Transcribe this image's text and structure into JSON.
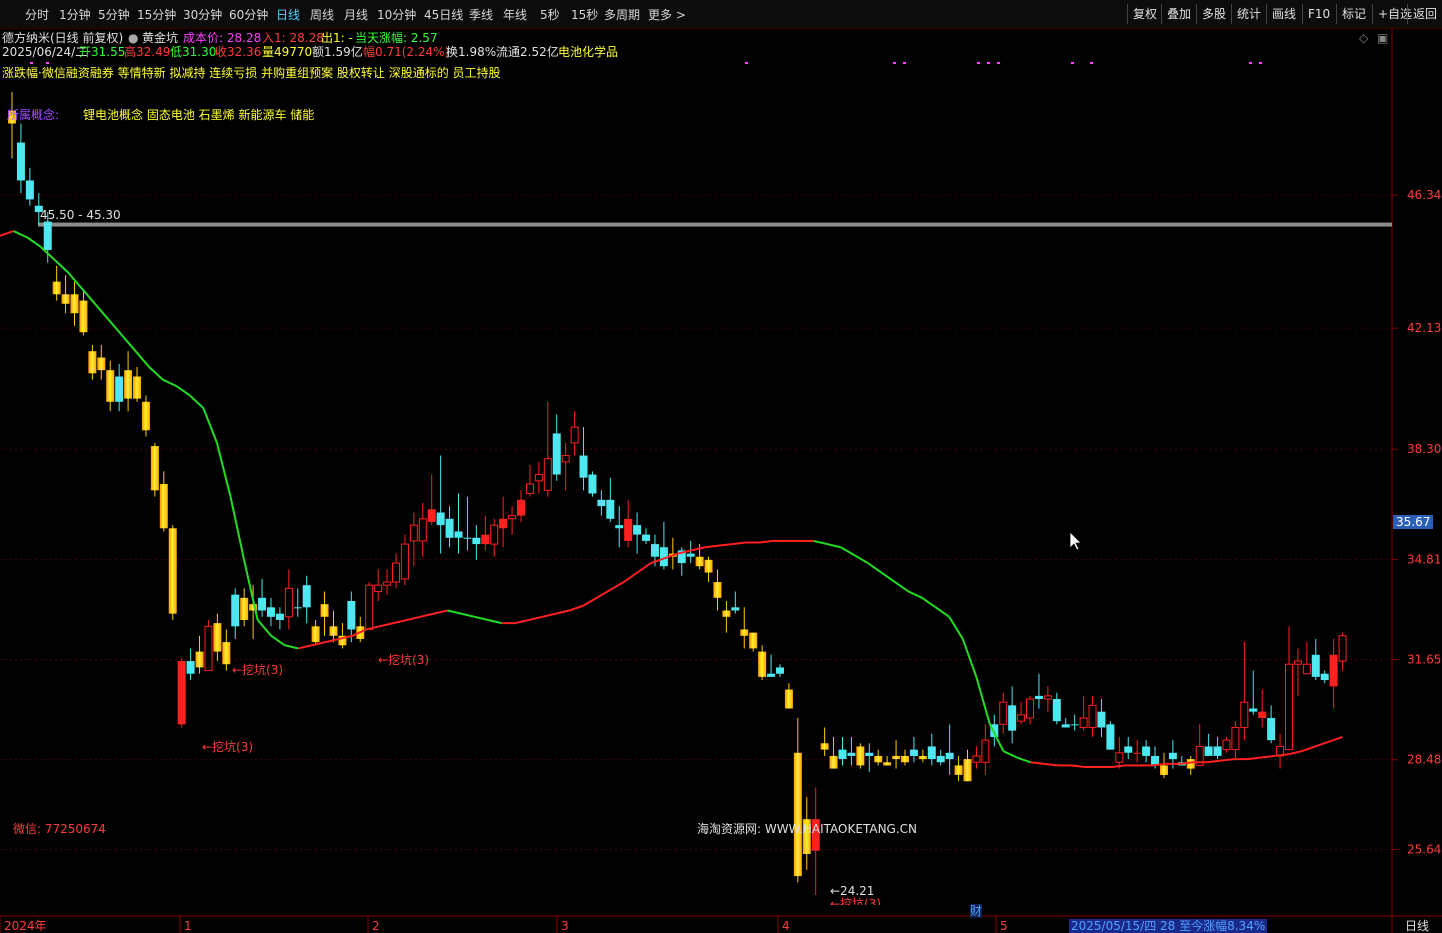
{
  "toolbar": {
    "left": [
      "分时",
      "1分钟",
      "5分钟",
      "15分钟",
      "30分钟",
      "60分钟",
      "日线",
      "周线",
      "月线",
      "10分钟",
      "45日线",
      "季线",
      "年线",
      "5秒",
      "15秒",
      "多周期",
      "更多 >"
    ],
    "active": "日线",
    "right": [
      "复权",
      "叠加",
      "多股",
      "统计",
      "画线",
      "F10",
      "标记",
      "+自选",
      "返回"
    ]
  },
  "header": {
    "stock": "德方纳米(日线 前复权)",
    "indicator_name": "黄金坑",
    "cost": "成本价: 28.28",
    "entry": "入1: 28.28",
    "exit": "出1: -",
    "today_change": "当天涨幅: 2.57",
    "date": "2025/06/24/二",
    "open": "开31.55",
    "high": "高32.49",
    "low": "低31.30",
    "close": "收32.36",
    "volume": "量49770",
    "amount": "额1.59亿",
    "change": "幅0.71(2.24%)",
    "turnover": "换1.98%",
    "float": "流通2.52亿",
    "sector": "电池化学品"
  },
  "news_line": "涨跌幅·微信融资融券 等情特新 拟减持 连续亏损 并购重组预案 股权转让 深股通标的 员工持股",
  "concepts": {
    "label": "所属概念:",
    "value": "锂电池概念 固态电池 石墨烯 新能源车 储能"
  },
  "wechat": "微信: 77250674",
  "watermark": "海淘资源网: WWW.HAITAOKETANG.CN",
  "level_label": "45.50 - 45.30",
  "low_label": "←24.21",
  "annotations": [
    "←挖坑(3)",
    "←挖坑(3)",
    "←挖坑(3)",
    "←挖坑(3)"
  ],
  "cai_label": "财",
  "x_axis": [
    "2024年",
    "1",
    "2",
    "3",
    "4",
    "5"
  ],
  "footer_info": "2025/05/15/四 28 至今涨幅8.34%",
  "period_label": "日线",
  "price_axis": [
    "46.34",
    "42.13",
    "38.30",
    "34.81",
    "31.65",
    "28.48",
    "25.64"
  ],
  "current_price": "35.67",
  "colors": {
    "up": "#ff3b3b",
    "down": "#4de8f0",
    "gold": "#ffcc00",
    "ma_up": "#ff2020",
    "ma_down": "#22dd22",
    "grid": "#4a0000"
  },
  "chart_data": {
    "type": "candlestick",
    "y_axis_ticks": [
      46.34,
      42.13,
      38.3,
      34.81,
      31.65,
      28.48,
      25.64
    ],
    "level_line": [
      45.5,
      45.3
    ],
    "min_low": 24.21,
    "candles": [
      [
        49.0,
        48.6,
        49.6,
        47.5,
        "gold"
      ],
      [
        46.8,
        48.0,
        48.6,
        46.4,
        "down"
      ],
      [
        46.2,
        46.8,
        47.2,
        46.0,
        "down"
      ],
      [
        46.0,
        45.8,
        46.4,
        45.4,
        "down"
      ],
      [
        45.5,
        44.6,
        45.8,
        44.2,
        "down"
      ],
      [
        43.2,
        43.6,
        44.1,
        43.0,
        "gold"
      ],
      [
        43.2,
        42.9,
        43.8,
        42.6,
        "gold"
      ],
      [
        43.2,
        42.6,
        43.6,
        42.2,
        "gold"
      ],
      [
        43.0,
        42.0,
        43.3,
        41.9,
        "gold"
      ],
      [
        41.4,
        40.7,
        41.6,
        40.5,
        "gold"
      ],
      [
        41.2,
        40.8,
        41.6,
        40.5,
        "gold"
      ],
      [
        40.8,
        39.8,
        41.1,
        39.5,
        "gold"
      ],
      [
        39.8,
        40.6,
        41.0,
        39.5,
        "down"
      ],
      [
        40.8,
        39.9,
        41.4,
        39.5,
        "gold"
      ],
      [
        40.6,
        39.9,
        40.9,
        39.8,
        "gold"
      ],
      [
        39.8,
        38.9,
        40.0,
        38.7,
        "gold"
      ],
      [
        38.4,
        37.0,
        38.5,
        36.8,
        "gold"
      ],
      [
        37.2,
        35.8,
        37.6,
        35.7,
        "gold"
      ],
      [
        35.8,
        33.1,
        35.9,
        32.9,
        "gold"
      ],
      [
        31.6,
        29.6,
        31.7,
        29.5,
        "up"
      ],
      [
        31.2,
        31.6,
        32.0,
        31.0,
        "down"
      ],
      [
        31.9,
        31.4,
        32.4,
        31.2,
        "gold"
      ],
      [
        31.3,
        32.7,
        32.9,
        31.3,
        "up"
      ],
      [
        32.8,
        31.9,
        33.1,
        31.6,
        "gold"
      ],
      [
        32.2,
        31.5,
        32.6,
        31.3,
        "gold"
      ],
      [
        32.7,
        33.7,
        33.9,
        32.3,
        "down"
      ],
      [
        33.6,
        32.9,
        33.9,
        32.7,
        "gold"
      ],
      [
        33.4,
        33.2,
        34.0,
        32.3,
        "gold"
      ],
      [
        33.2,
        33.6,
        34.2,
        33.0,
        "down"
      ],
      [
        33.3,
        33.0,
        33.6,
        32.7,
        "down"
      ],
      [
        32.9,
        33.1,
        33.3,
        32.6,
        "down"
      ],
      [
        33.0,
        33.9,
        34.5,
        32.6,
        "up"
      ],
      [
        33.3,
        33.3,
        33.9,
        33.0,
        "down"
      ],
      [
        33.3,
        34.0,
        34.3,
        32.8,
        "down"
      ],
      [
        32.7,
        32.2,
        32.9,
        32.1,
        "gold"
      ],
      [
        33.4,
        33.0,
        33.8,
        32.4,
        "gold"
      ],
      [
        32.7,
        32.4,
        33.2,
        32.2,
        "gold"
      ],
      [
        32.4,
        32.1,
        32.8,
        32.0,
        "gold"
      ],
      [
        32.6,
        33.5,
        33.8,
        32.2,
        "down"
      ],
      [
        32.7,
        32.3,
        33.0,
        32.2,
        "gold"
      ],
      [
        32.6,
        34.0,
        34.1,
        32.6,
        "up"
      ],
      [
        33.8,
        34.0,
        34.5,
        33.5,
        "up"
      ],
      [
        34.0,
        34.1,
        34.5,
        33.7,
        "up"
      ],
      [
        34.1,
        34.7,
        35.0,
        33.9,
        "up"
      ],
      [
        34.2,
        35.3,
        35.6,
        34.0,
        "up"
      ],
      [
        35.4,
        35.9,
        36.3,
        34.6,
        "up"
      ],
      [
        35.4,
        36.1,
        36.6,
        34.9,
        "up"
      ],
      [
        36.4,
        36.0,
        37.5,
        35.9,
        "up"
      ],
      [
        36.3,
        35.9,
        38.1,
        35.0,
        "down"
      ],
      [
        36.1,
        35.5,
        36.5,
        35.2,
        "down"
      ],
      [
        35.7,
        35.5,
        36.9,
        35.0,
        "down"
      ],
      [
        35.5,
        35.5,
        36.8,
        35.1,
        "down"
      ],
      [
        35.5,
        35.3,
        35.9,
        34.8,
        "down"
      ],
      [
        35.6,
        35.3,
        36.2,
        35.1,
        "up"
      ],
      [
        35.3,
        35.9,
        36.1,
        34.9,
        "up"
      ],
      [
        36.1,
        35.8,
        36.8,
        35.2,
        "up"
      ],
      [
        36.1,
        36.2,
        36.5,
        35.6,
        "up"
      ],
      [
        36.7,
        36.2,
        37.0,
        36.0,
        "up"
      ],
      [
        36.9,
        37.2,
        37.8,
        36.8,
        "up"
      ],
      [
        37.3,
        37.5,
        37.9,
        36.9,
        "up"
      ],
      [
        37.0,
        38.0,
        39.8,
        36.8,
        "up"
      ],
      [
        38.8,
        37.5,
        39.4,
        37.3,
        "down"
      ],
      [
        37.9,
        38.1,
        38.5,
        37.0,
        "up"
      ],
      [
        38.5,
        39.0,
        39.5,
        38.1,
        "up"
      ],
      [
        38.1,
        37.4,
        39.0,
        37.0,
        "down"
      ],
      [
        37.5,
        36.9,
        37.6,
        36.8,
        "down"
      ],
      [
        36.7,
        36.5,
        37.0,
        36.2,
        "down"
      ],
      [
        36.7,
        36.1,
        37.4,
        36.0,
        "down"
      ],
      [
        35.8,
        35.9,
        36.5,
        35.2,
        "down"
      ],
      [
        36.1,
        35.4,
        36.7,
        35.2,
        "up"
      ],
      [
        35.6,
        35.9,
        36.3,
        35.0,
        "down"
      ],
      [
        35.4,
        35.6,
        35.8,
        35.3,
        "down"
      ],
      [
        35.3,
        34.9,
        35.6,
        34.6,
        "down"
      ],
      [
        35.2,
        34.6,
        36.0,
        34.5,
        "down"
      ],
      [
        35.0,
        34.9,
        35.5,
        34.5,
        "gold"
      ],
      [
        35.1,
        34.7,
        35.2,
        34.3,
        "down"
      ],
      [
        35.0,
        34.9,
        35.4,
        34.7,
        "down"
      ],
      [
        34.9,
        34.6,
        35.3,
        34.5,
        "gold"
      ],
      [
        34.8,
        34.4,
        34.9,
        34.1,
        "gold"
      ],
      [
        34.1,
        33.6,
        34.5,
        33.2,
        "gold"
      ],
      [
        33.2,
        33.0,
        33.5,
        32.5,
        "gold"
      ],
      [
        33.3,
        33.2,
        33.8,
        33.1,
        "down"
      ],
      [
        32.4,
        32.6,
        33.3,
        32.0,
        "gold"
      ],
      [
        32.5,
        32.0,
        32.5,
        31.9,
        "gold"
      ],
      [
        31.9,
        31.1,
        32.1,
        31.0,
        "gold"
      ],
      [
        31.2,
        31.1,
        31.8,
        31.1,
        "down"
      ],
      [
        31.2,
        31.4,
        31.5,
        31.1,
        "down"
      ],
      [
        30.7,
        30.1,
        30.9,
        30.1,
        "gold"
      ],
      [
        28.7,
        24.8,
        29.8,
        24.6,
        "gold"
      ],
      [
        25.5,
        26.6,
        27.3,
        25.0,
        "gold"
      ],
      [
        26.6,
        25.6,
        27.6,
        24.2,
        "up"
      ],
      [
        29.0,
        28.8,
        29.5,
        28.6,
        "gold"
      ],
      [
        28.6,
        28.2,
        29.2,
        28.2,
        "gold"
      ],
      [
        28.5,
        28.8,
        29.2,
        28.3,
        "down"
      ],
      [
        28.6,
        28.7,
        29.2,
        28.3,
        "down"
      ],
      [
        28.9,
        28.3,
        29.0,
        28.2,
        "gold"
      ],
      [
        28.6,
        28.7,
        29.0,
        28.1,
        "down"
      ],
      [
        28.6,
        28.4,
        28.8,
        28.3,
        "gold"
      ],
      [
        28.4,
        28.3,
        28.6,
        28.3,
        "gold"
      ],
      [
        28.6,
        28.5,
        29.1,
        28.2,
        "gold"
      ],
      [
        28.6,
        28.4,
        28.8,
        28.3,
        "gold"
      ],
      [
        28.6,
        28.8,
        29.2,
        28.4,
        "down"
      ],
      [
        28.6,
        28.5,
        28.8,
        28.4,
        "gold"
      ],
      [
        28.9,
        28.5,
        29.3,
        28.3,
        "down"
      ],
      [
        28.6,
        28.4,
        28.8,
        28.3,
        "down"
      ],
      [
        28.5,
        28.7,
        29.6,
        28.0,
        "down"
      ],
      [
        28.3,
        28.0,
        28.6,
        27.8,
        "gold"
      ],
      [
        27.8,
        28.5,
        28.8,
        27.8,
        "gold"
      ],
      [
        28.4,
        28.6,
        28.9,
        28.2,
        "up"
      ],
      [
        28.4,
        29.1,
        29.6,
        28.0,
        "up"
      ],
      [
        29.2,
        29.6,
        29.9,
        28.9,
        "down"
      ],
      [
        29.6,
        30.3,
        30.6,
        29.3,
        "up"
      ],
      [
        30.2,
        29.4,
        30.8,
        29.0,
        "down"
      ],
      [
        29.7,
        29.9,
        30.3,
        29.6,
        "up"
      ],
      [
        29.8,
        30.4,
        30.5,
        29.6,
        "up"
      ],
      [
        30.4,
        30.5,
        31.2,
        30.1,
        "down"
      ],
      [
        30.4,
        30.5,
        30.8,
        30.0,
        "up"
      ],
      [
        30.4,
        29.7,
        30.6,
        29.6,
        "down"
      ],
      [
        29.6,
        29.5,
        29.8,
        29.5,
        "down"
      ],
      [
        29.6,
        29.6,
        29.9,
        29.4,
        "down"
      ],
      [
        29.5,
        29.8,
        30.5,
        29.4,
        "up"
      ],
      [
        29.5,
        30.2,
        30.5,
        29.2,
        "up"
      ],
      [
        30.0,
        29.5,
        30.4,
        29.2,
        "down"
      ],
      [
        29.6,
        28.8,
        29.7,
        28.8,
        "down"
      ],
      [
        28.4,
        28.7,
        29.2,
        28.2,
        "up"
      ],
      [
        28.9,
        28.7,
        29.2,
        28.5,
        "down"
      ],
      [
        28.7,
        28.7,
        29.1,
        28.4,
        "up"
      ],
      [
        28.6,
        28.9,
        29.1,
        28.4,
        "down"
      ],
      [
        28.6,
        28.3,
        28.9,
        28.2,
        "down"
      ],
      [
        28.3,
        28.0,
        28.7,
        27.9,
        "gold"
      ],
      [
        28.5,
        28.7,
        29.1,
        28.2,
        "down"
      ],
      [
        28.4,
        28.3,
        28.6,
        28.3,
        "down"
      ],
      [
        28.5,
        28.2,
        28.6,
        28.0,
        "gold"
      ],
      [
        28.3,
        28.9,
        29.6,
        28.3,
        "up"
      ],
      [
        28.9,
        28.6,
        29.3,
        28.6,
        "down"
      ],
      [
        28.6,
        28.9,
        29.2,
        28.5,
        "down"
      ],
      [
        28.8,
        29.1,
        29.2,
        28.7,
        "up"
      ],
      [
        28.8,
        29.5,
        29.7,
        28.5,
        "up"
      ],
      [
        29.5,
        30.3,
        32.2,
        29.1,
        "up"
      ],
      [
        30.1,
        30.0,
        31.3,
        29.9,
        "down"
      ],
      [
        30.0,
        29.8,
        30.7,
        29.5,
        "up"
      ],
      [
        29.8,
        29.1,
        30.2,
        29.0,
        "down"
      ],
      [
        28.6,
        28.9,
        29.3,
        28.2,
        "up"
      ],
      [
        28.8,
        31.5,
        32.7,
        28.8,
        "up"
      ],
      [
        31.5,
        31.6,
        32.0,
        30.5,
        "up"
      ],
      [
        31.2,
        31.5,
        32.2,
        31.2,
        "up"
      ],
      [
        31.8,
        31.1,
        32.3,
        31.0,
        "down"
      ],
      [
        31.0,
        31.2,
        31.3,
        30.9,
        "down"
      ],
      [
        31.8,
        30.8,
        32.3,
        30.1,
        "up"
      ],
      [
        31.6,
        32.4,
        32.5,
        31.3,
        "up"
      ]
    ],
    "ma_line": {
      "values": [
        45.05,
        45.2,
        45.0,
        44.7,
        44.3,
        43.9,
        43.4,
        42.9,
        42.4,
        41.9,
        41.4,
        40.9,
        40.5,
        40.3,
        40.0,
        39.6,
        38.5,
        36.8,
        34.8,
        32.9,
        32.4,
        32.1,
        32.0,
        32.1,
        32.2,
        32.3,
        32.4,
        32.6,
        32.7,
        32.8,
        32.9,
        33.0,
        33.1,
        33.2,
        33.1,
        33.0,
        32.9,
        32.8,
        32.8,
        32.9,
        33.0,
        33.1,
        33.2,
        33.35,
        33.6,
        33.85,
        34.1,
        34.4,
        34.7,
        34.85,
        35.0,
        35.1,
        35.2,
        35.25,
        35.3,
        35.35,
        35.35,
        35.4,
        35.4,
        35.4,
        35.4,
        35.3,
        35.2,
        34.95,
        34.7,
        34.4,
        34.1,
        33.8,
        33.6,
        33.3,
        33.0,
        32.3,
        31.1,
        29.6,
        28.75,
        28.55,
        28.4,
        28.35,
        28.3,
        28.3,
        28.25,
        28.25,
        28.25,
        28.3,
        28.3,
        28.3,
        28.35,
        28.35,
        28.4,
        28.4,
        28.45,
        28.5,
        28.5,
        28.55,
        28.6,
        28.65,
        28.75,
        28.9,
        29.05,
        29.2
      ],
      "start_index": 3
    }
  }
}
